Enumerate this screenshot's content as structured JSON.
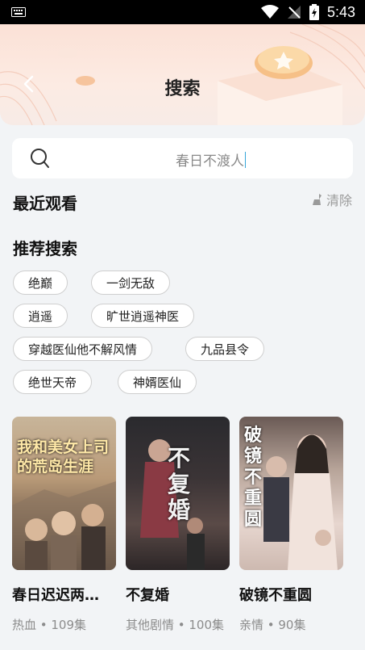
{
  "status_bar": {
    "time": "5:43"
  },
  "header": {
    "title": "搜索"
  },
  "search": {
    "value": "春日不渡人"
  },
  "recent": {
    "title": "最近观看",
    "clear_label": "清除"
  },
  "recommend": {
    "title": "推荐搜索",
    "tags": [
      "绝巅",
      "一剑无敌",
      "逍遥",
      "旷世逍遥神医",
      "穿越医仙他不解风情",
      "九品县令",
      "绝世天帝",
      "神婿医仙"
    ]
  },
  "dramas": [
    {
      "name": "春日迟迟两…",
      "meta": "热血 • 109集",
      "poster_text": "我和美女上司的荒岛生涯"
    },
    {
      "name": "不复婚",
      "meta": "其他剧情 • 100集",
      "poster_text": "不复婚"
    },
    {
      "name": "破镜不重圆",
      "meta": "亲情 • 90集",
      "poster_text": "破镜不重圆"
    }
  ]
}
